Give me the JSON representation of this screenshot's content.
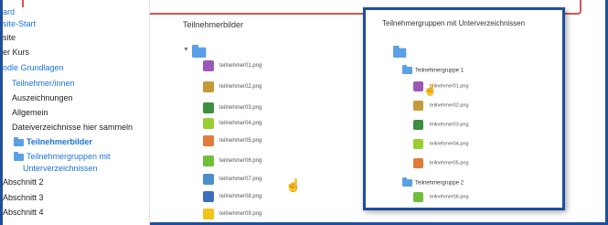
{
  "sidebar": {
    "items": [
      {
        "label": "ard",
        "style": "link"
      },
      {
        "label": "site-Start",
        "style": "link"
      },
      {
        "label": "site",
        "style": "plain"
      },
      {
        "label": "er Kurs",
        "style": "plain"
      },
      {
        "label": "odle Grundlagen",
        "style": "link"
      },
      {
        "label": "Teilnehmer/innen",
        "style": "link"
      },
      {
        "label": "Auszeichnungen",
        "style": "plain"
      },
      {
        "label": "Allgemein",
        "style": "plain"
      },
      {
        "label": "Dateiverzeichnisse hier sammeln",
        "style": "plain"
      },
      {
        "label": "Teilnehmerbilder",
        "style": "bold"
      },
      {
        "label": "Teilnehmergruppen mit",
        "style": "link"
      },
      {
        "label": "Unterverzeichnissen",
        "style": "link"
      },
      {
        "label": "Abschnitt 2",
        "style": "plain"
      },
      {
        "label": "Abschnitt 3",
        "style": "plain"
      },
      {
        "label": "Abschnitt 4",
        "style": "plain"
      }
    ]
  },
  "main": {
    "title": "Teilnehmerbilder",
    "files": [
      {
        "name": "teilnehmer01.png",
        "color": "#9b59b6"
      },
      {
        "name": "teilnehmer02.png",
        "color": "#c49a3a"
      },
      {
        "name": "teilnehmer03.png",
        "color": "#3e8e41"
      },
      {
        "name": "teilnehmer04.png",
        "color": "#9acd32"
      },
      {
        "name": "teilnehmer05.png",
        "color": "#e07b39"
      },
      {
        "name": "teilnehmer06.png",
        "color": "#6fbf3a"
      },
      {
        "name": "teilnehmer07.png",
        "color": "#4a90c8"
      },
      {
        "name": "teilnehmer08.png",
        "color": "#3a6fbf"
      },
      {
        "name": "teilnehmer09.png",
        "color": "#f0c419"
      }
    ]
  },
  "popup": {
    "title": "Teilnehmergruppen mit Unterverzeichnissen",
    "group1": "Teilnehmergruppe 1",
    "group1_files": [
      {
        "name": "teilnehmer01.png",
        "color": "#9b59b6"
      },
      {
        "name": "teilnehmer02.png",
        "color": "#c49a3a"
      },
      {
        "name": "teilnehmer03.png",
        "color": "#3e8e41"
      },
      {
        "name": "teilnehmer04.png",
        "color": "#9acd32"
      },
      {
        "name": "teilnehmer05.png",
        "color": "#e07b39"
      }
    ],
    "group2": "Teilnehmergruppe 2",
    "group2_files": [
      {
        "name": "teilnehmer06.png",
        "color": "#6fbf3a"
      }
    ]
  },
  "colors": {
    "frame": "#1f4e9c",
    "banner_border": "#d9534f",
    "link": "#1a73d9",
    "folder": "#5aa0e6"
  }
}
